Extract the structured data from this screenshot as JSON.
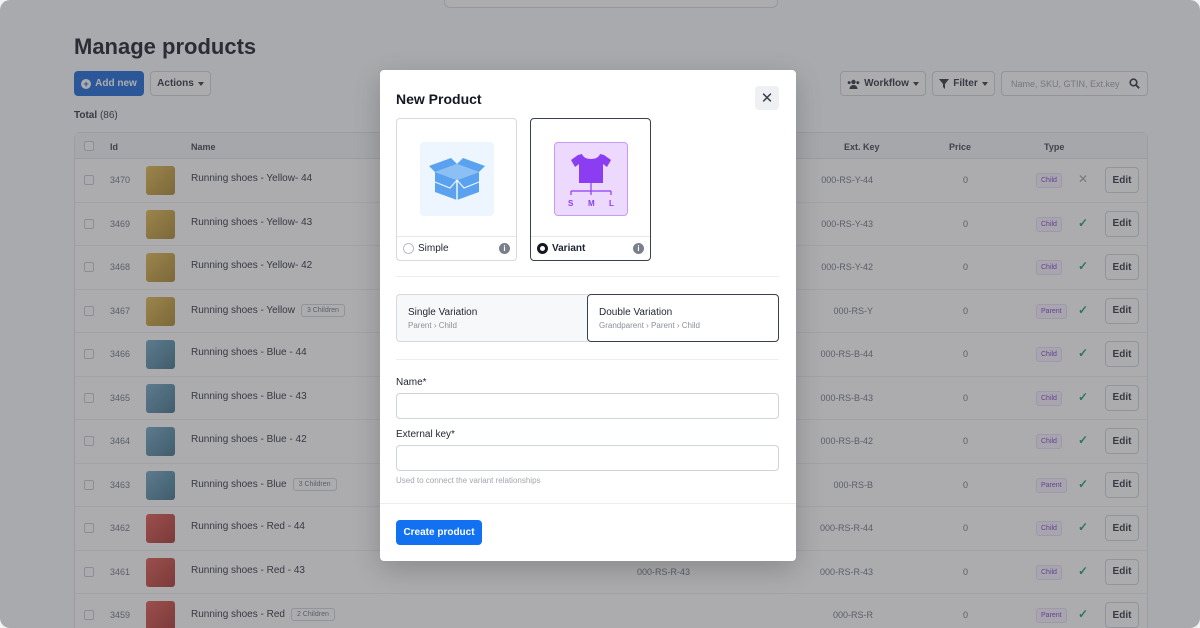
{
  "page": {
    "title": "Manage products",
    "add_new_label": "Add new",
    "actions_label": "Actions",
    "workflow_label": "Workflow",
    "filter_label": "Filter",
    "search_placeholder": "Name, SKU, GTIN, Ext.key",
    "total_label": "Total",
    "total_count": "(86)"
  },
  "table": {
    "headers": {
      "id": "Id",
      "name": "Name",
      "ext_key": "Ext. Key",
      "price": "Price",
      "type": "Type"
    },
    "edit_label": "Edit",
    "rows": [
      {
        "id": "3470",
        "name": "Running shoes - Yellow- 44",
        "children": "",
        "sku": "",
        "ext": "000-RS-Y-44",
        "price": "0",
        "type": "Child",
        "status": "✕",
        "color": "y"
      },
      {
        "id": "3469",
        "name": "Running shoes - Yellow- 43",
        "children": "",
        "sku": "",
        "ext": "000-RS-Y-43",
        "price": "0",
        "type": "Child",
        "status": "✓",
        "color": "y"
      },
      {
        "id": "3468",
        "name": "Running shoes - Yellow- 42",
        "children": "",
        "sku": "",
        "ext": "000-RS-Y-42",
        "price": "0",
        "type": "Child",
        "status": "✓",
        "color": "y"
      },
      {
        "id": "3467",
        "name": "Running shoes - Yellow",
        "children": "3 Children",
        "sku": "",
        "ext": "000-RS-Y",
        "price": "0",
        "type": "Parent",
        "status": "✓",
        "color": "y"
      },
      {
        "id": "3466",
        "name": "Running shoes - Blue - 44",
        "children": "",
        "sku": "",
        "ext": "000-RS-B-44",
        "price": "0",
        "type": "Child",
        "status": "✓",
        "color": "b"
      },
      {
        "id": "3465",
        "name": "Running shoes - Blue - 43",
        "children": "",
        "sku": "",
        "ext": "000-RS-B-43",
        "price": "0",
        "type": "Child",
        "status": "✓",
        "color": "b"
      },
      {
        "id": "3464",
        "name": "Running shoes - Blue - 42",
        "children": "",
        "sku": "",
        "ext": "000-RS-B-42",
        "price": "0",
        "type": "Child",
        "status": "✓",
        "color": "b"
      },
      {
        "id": "3463",
        "name": "Running shoes - Blue",
        "children": "3 Children",
        "sku": "",
        "ext": "000-RS-B",
        "price": "0",
        "type": "Parent",
        "status": "✓",
        "color": "b"
      },
      {
        "id": "3462",
        "name": "Running shoes - Red - 44",
        "children": "",
        "sku": "",
        "ext": "000-RS-R-44",
        "price": "0",
        "type": "Child",
        "status": "✓",
        "color": "r"
      },
      {
        "id": "3461",
        "name": "Running shoes - Red - 43",
        "children": "",
        "sku": "000-RS-R-43",
        "ext": "000-RS-R-43",
        "price": "0",
        "type": "Child",
        "status": "✓",
        "color": "r"
      },
      {
        "id": "3459",
        "name": "Running shoes - Red",
        "children": "2 Children",
        "sku": "",
        "ext": "000-RS-R",
        "price": "0",
        "type": "Parent",
        "status": "✓",
        "color": "r"
      }
    ]
  },
  "modal": {
    "title": "New Product",
    "close_icon": "close-icon",
    "types": [
      {
        "label": "Simple",
        "selected": false,
        "icon": "open-box-icon"
      },
      {
        "label": "Variant",
        "selected": true,
        "icon": "tshirt-sizes-icon",
        "sizes": [
          "S",
          "M",
          "L"
        ]
      }
    ],
    "variations": [
      {
        "title": "Single Variation",
        "path": [
          "Parent",
          "Child"
        ],
        "selected": false
      },
      {
        "title": "Double Variation",
        "path": [
          "Grandparent",
          "Parent",
          "Child"
        ],
        "selected": true
      }
    ],
    "name_label": "Name*",
    "name_value": "",
    "ext_key_label": "External key*",
    "ext_key_value": "",
    "ext_key_help": "Used to connect the variant relationships",
    "create_label": "Create product"
  },
  "colors": {
    "primary": "#1271f0",
    "accent_purple": "#8b3df2",
    "simple_icon": "#5aa2ef",
    "success": "#1b9e56"
  }
}
